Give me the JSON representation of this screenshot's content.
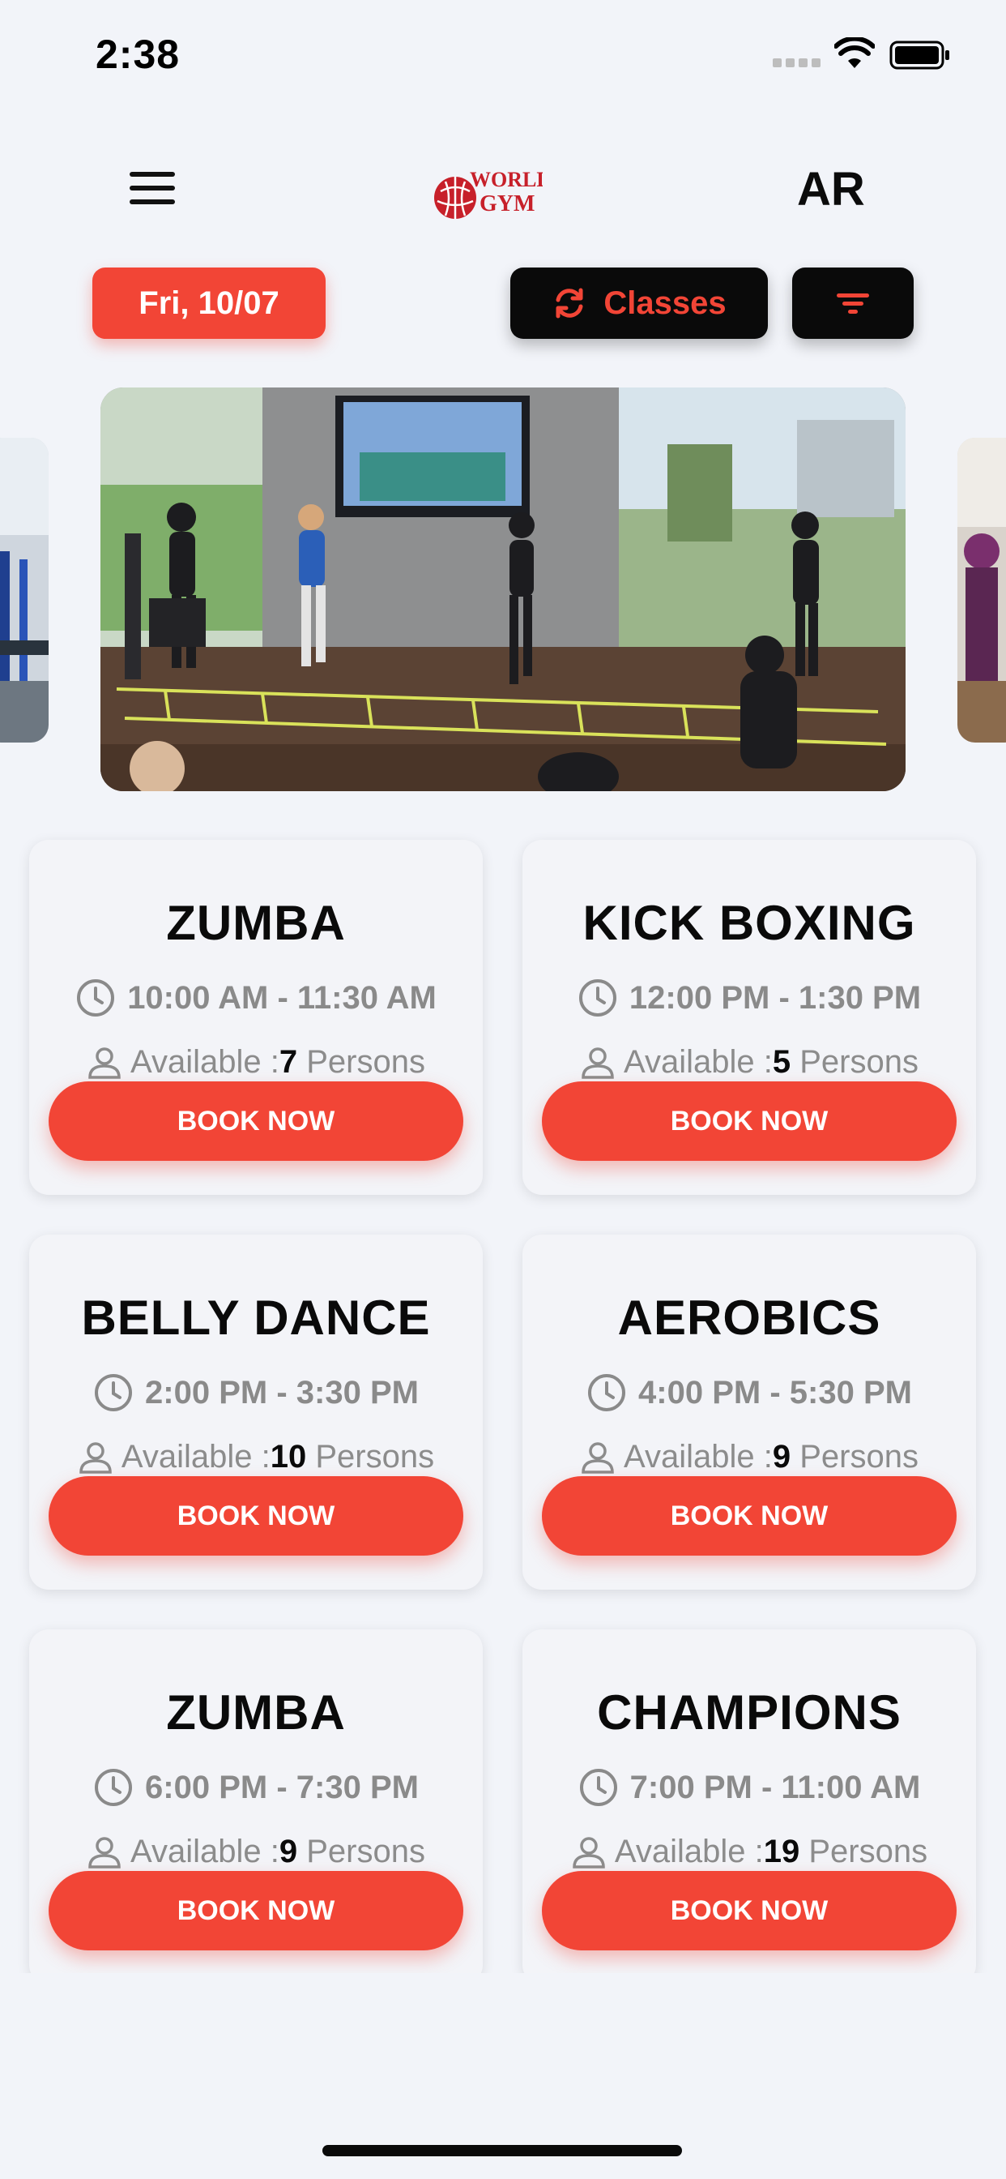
{
  "status_bar": {
    "time": "2:38"
  },
  "header": {
    "logo_alt": "WORLD GYM",
    "language_toggle": "AR"
  },
  "actions": {
    "date": "Fri, 10/07",
    "view_toggle": "Classes"
  },
  "colors": {
    "accent": "#f24536",
    "dark": "#0a0a0a",
    "background": "#f2f4f9"
  },
  "classes": [
    {
      "name": "ZUMBA",
      "time": "10:00 AM - 11:30 AM",
      "avail_prefix": "Available :",
      "count": "7",
      "avail_suffix": "Persons",
      "button": "BOOK NOW"
    },
    {
      "name": "KICK BOXING",
      "time": "12:00 PM - 1:30 PM",
      "avail_prefix": "Available :",
      "count": "5",
      "avail_suffix": "Persons",
      "button": "BOOK NOW"
    },
    {
      "name": "BELLY DANCE",
      "time": "2:00 PM - 3:30 PM",
      "avail_prefix": "Available :",
      "count": "10",
      "avail_suffix": "Persons",
      "button": "BOOK NOW"
    },
    {
      "name": "AEROBICS",
      "time": "4:00 PM - 5:30 PM",
      "avail_prefix": "Available :",
      "count": "9",
      "avail_suffix": "Persons",
      "button": "BOOK NOW"
    },
    {
      "name": "ZUMBA",
      "time": "6:00 PM - 7:30 PM",
      "avail_prefix": "Available :",
      "count": "9",
      "avail_suffix": "Persons",
      "button": "BOOK NOW"
    },
    {
      "name": "CHAMPIONS",
      "time": "7:00 PM - 11:00 AM",
      "avail_prefix": "Available :",
      "count": "19",
      "avail_suffix": "Persons",
      "button": "BOOK NOW"
    }
  ]
}
